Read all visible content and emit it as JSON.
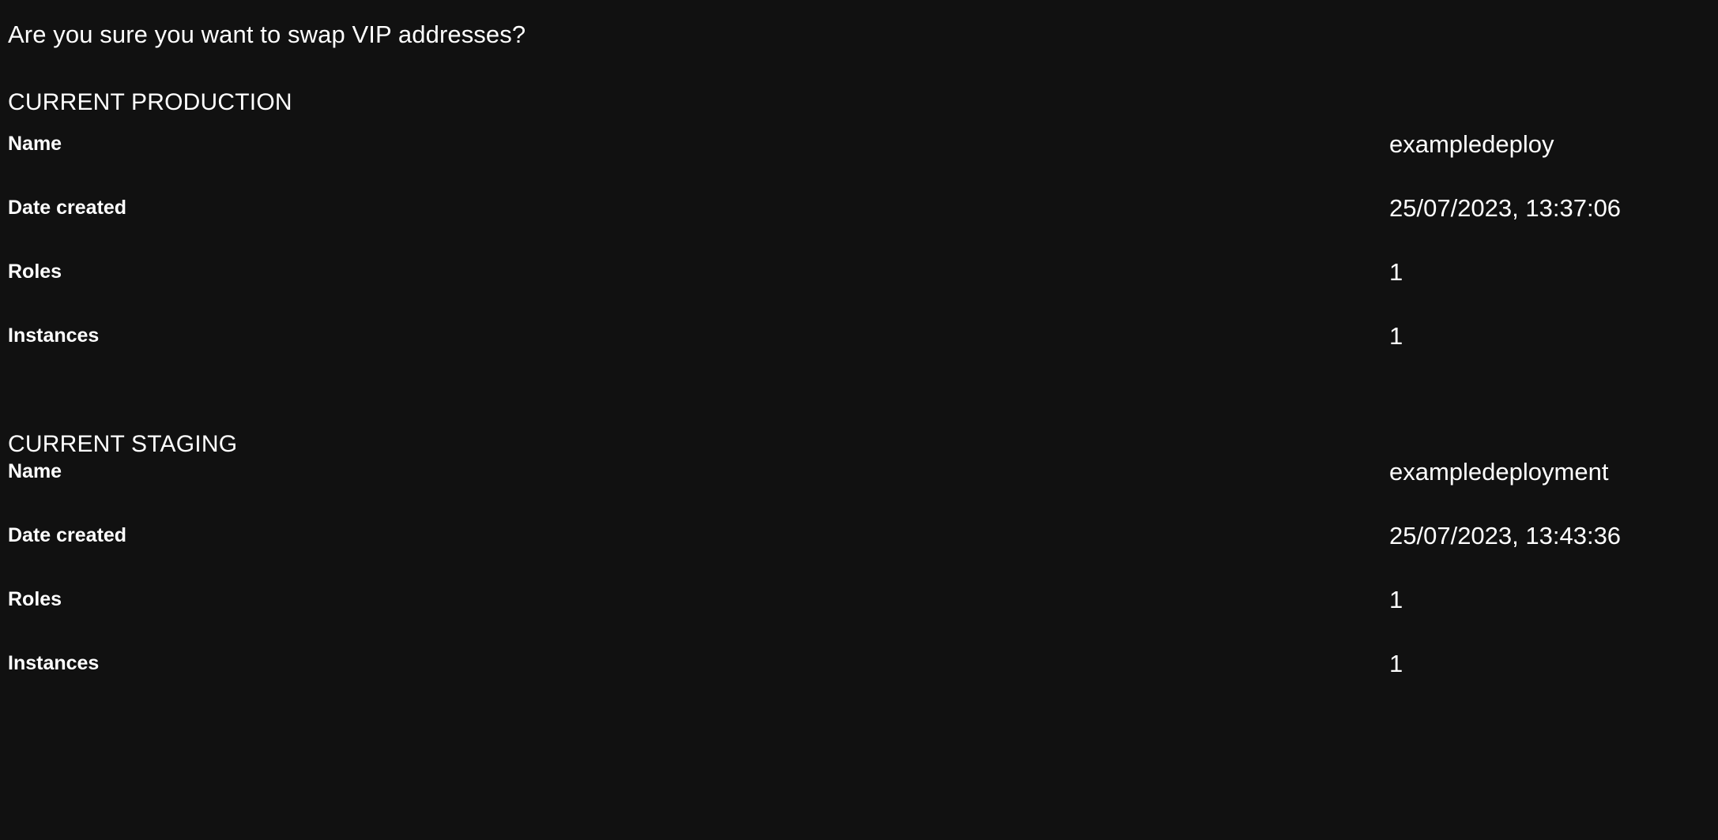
{
  "dialog": {
    "question": "Are you sure you want to swap VIP addresses?"
  },
  "sections": {
    "production": {
      "heading": "CURRENT PRODUCTION",
      "rows": [
        {
          "label": "Name",
          "value": "exampledeploy"
        },
        {
          "label": "Date created",
          "value": "25/07/2023, 13:37:06"
        },
        {
          "label": "Roles",
          "value": "1"
        },
        {
          "label": "Instances",
          "value": "1"
        }
      ]
    },
    "staging": {
      "heading": "CURRENT STAGING",
      "rows": [
        {
          "label": "Name",
          "value": "exampledeployment"
        },
        {
          "label": "Date created",
          "value": "25/07/2023, 13:43:36"
        },
        {
          "label": "Roles",
          "value": "1"
        },
        {
          "label": "Instances",
          "value": "1"
        }
      ]
    }
  },
  "colors": {
    "background": "#111111",
    "text": "#ffffff"
  }
}
